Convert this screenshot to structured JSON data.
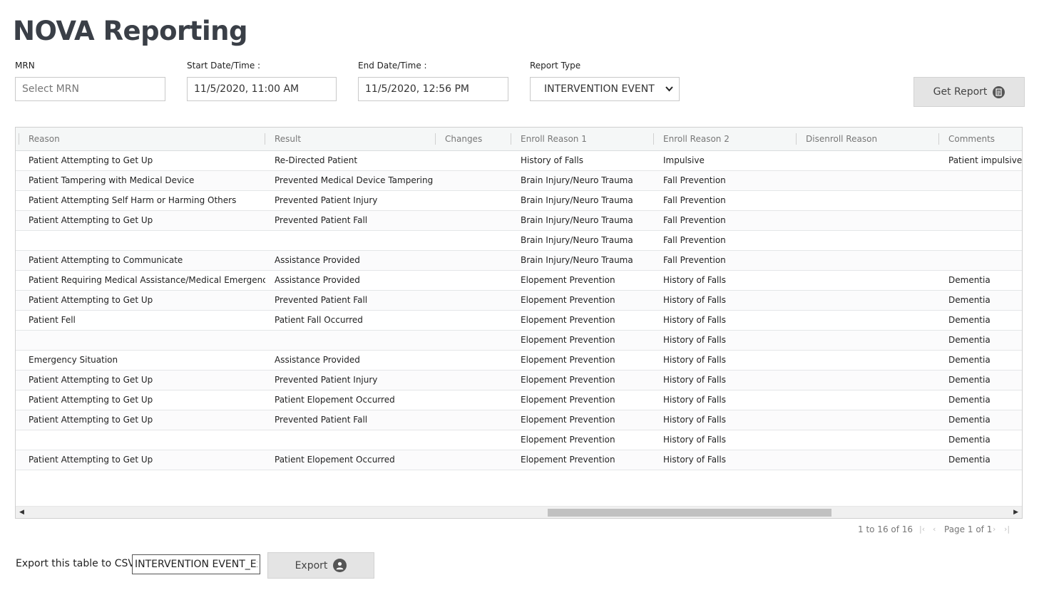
{
  "title": "NOVA Reporting",
  "filters": {
    "mrn": {
      "label": "MRN",
      "placeholder": "Select MRN",
      "value": ""
    },
    "start": {
      "label": "Start Date/Time :",
      "value": "11/5/2020, 11:00 AM"
    },
    "end": {
      "label": "End Date/Time :",
      "value": "11/5/2020, 12:56 PM"
    },
    "report_type": {
      "label": "Report Type",
      "value": "INTERVENTION EVENT"
    }
  },
  "get_report_label": "Get Report",
  "table": {
    "headers": [
      "Reason",
      "Result",
      "Changes",
      "Enroll Reason 1",
      "Enroll Reason 2",
      "Disenroll Reason",
      "Comments"
    ],
    "rows": [
      [
        "Patient Attempting to Get Up",
        "Re-Directed Patient",
        "",
        "History of Falls",
        "Impulsive",
        "",
        "Patient impulsive."
      ],
      [
        "Patient Tampering with Medical Device",
        "Prevented Medical Device Tampering",
        "",
        "Brain Injury/Neuro Trauma",
        "Fall Prevention",
        "",
        ""
      ],
      [
        "Patient Attempting Self Harm or Harming Others",
        "Prevented Patient Injury",
        "",
        "Brain Injury/Neuro Trauma",
        "Fall Prevention",
        "",
        ""
      ],
      [
        "Patient Attempting to Get Up",
        "Prevented Patient Fall",
        "",
        "Brain Injury/Neuro Trauma",
        "Fall Prevention",
        "",
        ""
      ],
      [
        "",
        "",
        "",
        "Brain Injury/Neuro Trauma",
        "Fall Prevention",
        "",
        ""
      ],
      [
        "Patient Attempting to Communicate",
        "Assistance Provided",
        "",
        "Brain Injury/Neuro Trauma",
        "Fall Prevention",
        "",
        ""
      ],
      [
        "Patient Requiring Medical Assistance/Medical Emergency",
        "Assistance Provided",
        "",
        "Elopement Prevention",
        "History of Falls",
        "",
        "Dementia"
      ],
      [
        "Patient Attempting to Get Up",
        "Prevented Patient Fall",
        "",
        "Elopement Prevention",
        "History of Falls",
        "",
        "Dementia"
      ],
      [
        "Patient Fell",
        "Patient Fall Occurred",
        "",
        "Elopement Prevention",
        "History of Falls",
        "",
        "Dementia"
      ],
      [
        "",
        "",
        "",
        "Elopement Prevention",
        "History of Falls",
        "",
        "Dementia"
      ],
      [
        "Emergency Situation",
        "Assistance Provided",
        "",
        "Elopement Prevention",
        "History of Falls",
        "",
        "Dementia"
      ],
      [
        "Patient Attempting to Get Up",
        "Prevented Patient Injury",
        "",
        "Elopement Prevention",
        "History of Falls",
        "",
        "Dementia"
      ],
      [
        "Patient Attempting to Get Up",
        "Patient Elopement Occurred",
        "",
        "Elopement Prevention",
        "History of Falls",
        "",
        "Dementia"
      ],
      [
        "Patient Attempting to Get Up",
        "Prevented Patient Fall",
        "",
        "Elopement Prevention",
        "History of Falls",
        "",
        "Dementia"
      ],
      [
        "",
        "",
        "",
        "Elopement Prevention",
        "History of Falls",
        "",
        "Dementia"
      ],
      [
        "Patient Attempting to Get Up",
        "Patient Elopement Occurred",
        "",
        "Elopement Prevention",
        "History of Falls",
        "",
        "Dementia"
      ]
    ]
  },
  "pagination": {
    "summary": "1 to 16 of 16",
    "page_label": "Page 1 of 1",
    "first": "|‹",
    "prev": "‹",
    "next": "›",
    "last": "›|"
  },
  "export": {
    "label": "Export this table to CSV:",
    "filename": "INTERVENTION EVENT_Export",
    "button_label": "Export"
  },
  "icons": {
    "get_report": "document-icon",
    "export": "user-download-icon",
    "select": "chevron-down-icon",
    "scroll_left": "scroll-left-arrow",
    "scroll_right": "scroll-right-arrow"
  }
}
